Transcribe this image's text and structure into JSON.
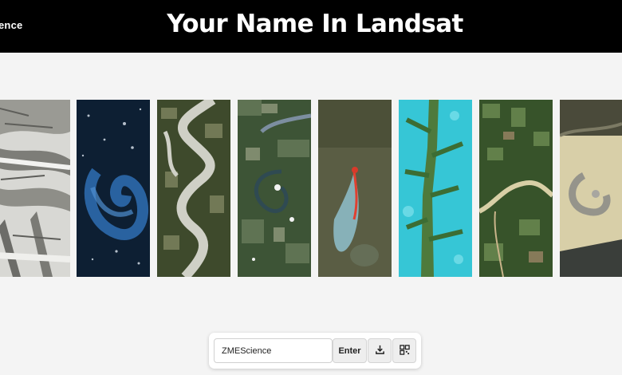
{
  "header": {
    "brand": "ence",
    "title": "Your Name In Landsat"
  },
  "images": [
    {
      "name": "glacier-ridges",
      "letter": "Y"
    },
    {
      "name": "ocean-bloom",
      "letter": "O"
    },
    {
      "name": "meandering-river",
      "letter": "U"
    },
    {
      "name": "farmland-oxbow",
      "letter": "R"
    },
    {
      "name": "wildfire-smoke",
      "letter": "N"
    },
    {
      "name": "cyan-valley",
      "letter": "A"
    },
    {
      "name": "river-fields",
      "letter": "M"
    },
    {
      "name": "desert-arc",
      "letter": "E"
    }
  ],
  "controls": {
    "name_value": "ZMEScience",
    "enter_label": "Enter",
    "download_icon": "download-icon",
    "qr_icon": "qr-code-icon"
  }
}
